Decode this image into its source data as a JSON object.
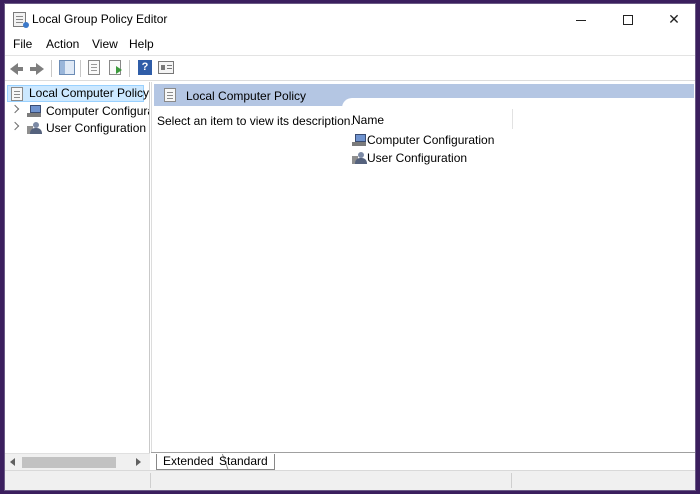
{
  "window": {
    "title": "Local Group Policy Editor",
    "controls": {
      "minimize": "minimize",
      "maximize": "maximize",
      "close": "✕"
    }
  },
  "menu": {
    "items": [
      "File",
      "Action",
      "View",
      "Help"
    ]
  },
  "toolbar": {
    "buttons": [
      "back-arrow-icon",
      "forward-arrow-icon",
      "show-hide-tree-icon",
      "list-view-icon",
      "export-list-icon",
      "help-icon",
      "properties-icon"
    ]
  },
  "tree": {
    "root": "Local Computer Policy",
    "children": [
      {
        "label": "Computer Configura",
        "icon": "computer-icon"
      },
      {
        "label": "User Configuration",
        "icon": "user-icon"
      }
    ]
  },
  "details": {
    "header_title": "Local Computer Policy",
    "description": "Select an item to view its description.",
    "column_name": "Name",
    "items": [
      {
        "label": "Computer Configuration",
        "icon": "computer-icon"
      },
      {
        "label": "User Configuration",
        "icon": "user-icon"
      }
    ]
  },
  "tabs": {
    "extended": "Extended",
    "standard": "Standard"
  },
  "colors": {
    "accent_header": "#b4c6e3",
    "selection": "#cce8ff",
    "background_frame": "#3b1f5e"
  }
}
